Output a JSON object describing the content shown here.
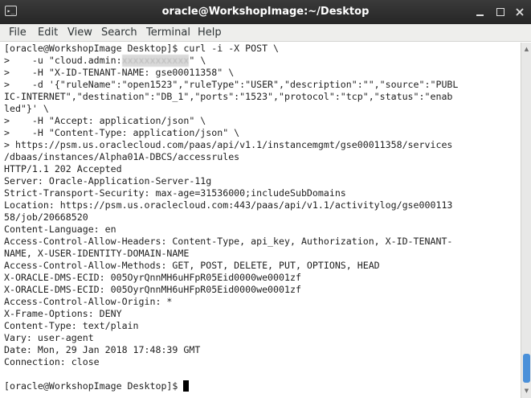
{
  "window": {
    "title": "oracle@WorkshopImage:~/Desktop",
    "app_icon_glyph": "▸_"
  },
  "menu": [
    "File",
    "Edit",
    "View",
    "Search",
    "Terminal",
    "Help"
  ],
  "terminal": {
    "lines": [
      "[oracle@WorkshopImage Desktop]$ curl -i -X POST \\",
      ">    -u \"cloud.admin:",
      ">    -H \"X-ID-TENANT-NAME: gse00011358\" \\",
      ">    -d '{\"ruleName\":\"open1523\",\"ruleType\":\"USER\",\"description\":\"\",\"source\":\"PUBL",
      "IC-INTERNET\",\"destination\":\"DB_1\",\"ports\":\"1523\",\"protocol\":\"tcp\",\"status\":\"enab",
      "led\"}' \\",
      ">    -H \"Accept: application/json\" \\",
      ">    -H \"Content-Type: application/json\" \\",
      "> https://psm.us.oraclecloud.com/paas/api/v1.1/instancemgmt/gse00011358/services",
      "/dbaas/instances/Alpha01A-DBCS/accessrules",
      "HTTP/1.1 202 Accepted",
      "Server: Oracle-Application-Server-11g",
      "Strict-Transport-Security: max-age=31536000;includeSubDomains",
      "Location: https://psm.us.oraclecloud.com:443/paas/api/v1.1/activitylog/gse000113",
      "58/job/20668520",
      "Content-Language: en",
      "Access-Control-Allow-Headers: Content-Type, api_key, Authorization, X-ID-TENANT-",
      "NAME, X-USER-IDENTITY-DOMAIN-NAME",
      "Access-Control-Allow-Methods: GET, POST, DELETE, PUT, OPTIONS, HEAD",
      "X-ORACLE-DMS-ECID: 005OyrQnnMH6uHFpR05Eid0000we0001zf",
      "X-ORACLE-DMS-ECID: 005OyrQnnMH6uHFpR05Eid0000we0001zf",
      "Access-Control-Allow-Origin: *",
      "X-Frame-Options: DENY",
      "Content-Type: text/plain",
      "Vary: user-agent",
      "Date: Mon, 29 Jan 2018 17:48:39 GMT",
      "Connection: close",
      "",
      "[oracle@WorkshopImage Desktop]$ "
    ],
    "redacted_password_suffix": "\" \\",
    "prompt_line_index": 28
  },
  "scrollbar": {
    "up_arrow": "▲",
    "down_arrow": "▼"
  },
  "colors": {
    "titlebar": "#2f2f2f",
    "menubar": "#eeeeec",
    "terminal_bg": "#ffffff",
    "terminal_fg": "#1e1e1e",
    "scroll_thumb": "#4a90d9"
  },
  "icons": [
    "terminal-app-icon",
    "minimize-icon",
    "maximize-icon",
    "close-icon"
  ]
}
